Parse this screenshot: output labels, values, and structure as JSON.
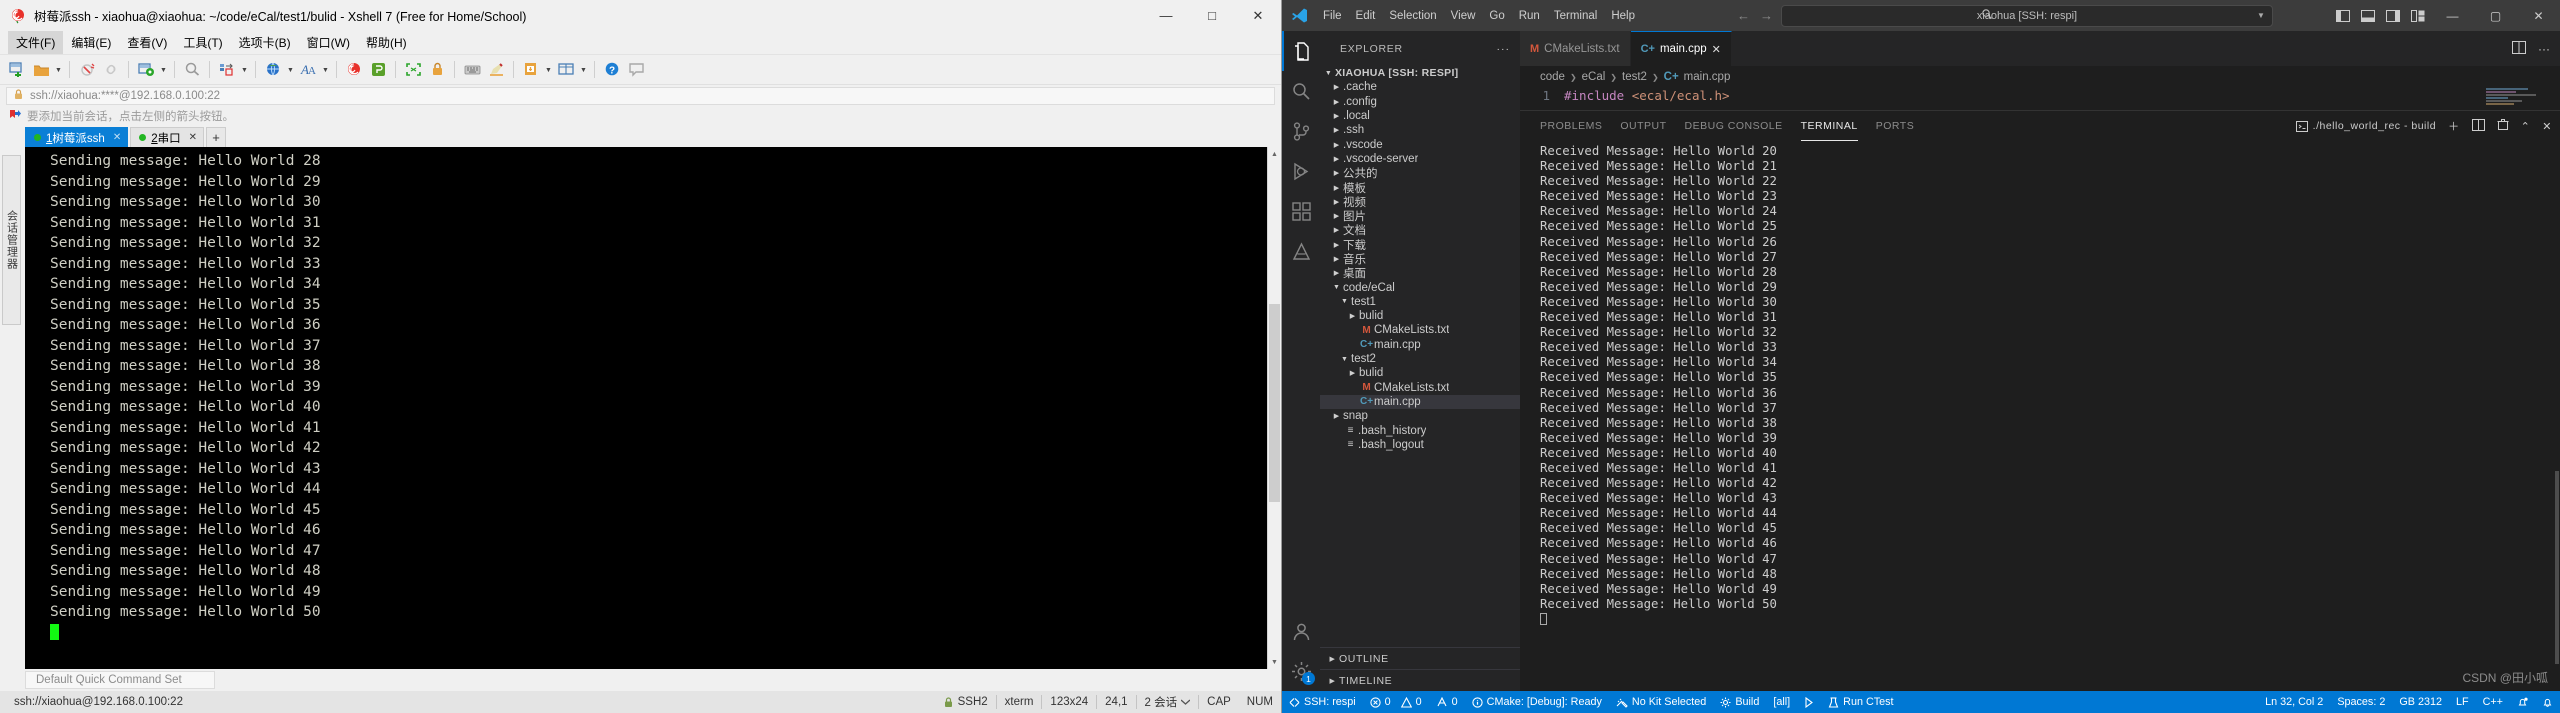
{
  "xshell": {
    "window_title": "树莓派ssh - xiaohua@xiaohua: ~/code/eCal/test1/bulid - Xshell 7 (Free for Home/School)",
    "logo_icon": "rose-icon",
    "window_buttons": [
      {
        "name": "minimize-button",
        "glyph": "—"
      },
      {
        "name": "maximize-button",
        "glyph": "□"
      },
      {
        "name": "close-button",
        "glyph": "✕"
      }
    ],
    "menu": [
      {
        "label": "文件(F)",
        "active": true
      },
      {
        "label": "编辑(E)",
        "active": false
      },
      {
        "label": "查看(V)",
        "active": false
      },
      {
        "label": "工具(T)",
        "active": false
      },
      {
        "label": "选项卡(B)",
        "active": false
      },
      {
        "label": "窗口(W)",
        "active": false
      },
      {
        "label": "帮助(H)",
        "active": false
      }
    ],
    "address": {
      "lock_icon": "lock-icon",
      "value": "ssh://xiaohua:****@192.168.0.100:22"
    },
    "notice": {
      "icon": "bookmark-arrow-icon",
      "text": "要添加当前会话，点击左侧的箭头按钮。"
    },
    "tabs": [
      {
        "label_num": "1",
        "label_rest": "树莓派ssh",
        "active": true,
        "dot_color": "#21b521"
      },
      {
        "label_num": "2",
        "label_rest": "串口",
        "active": false,
        "dot_color": "#21b521"
      }
    ],
    "tab_add_label": "+",
    "side_tab_label": "会话管理器",
    "terminal_lines": [
      "Sending message: Hello World 28",
      "Sending message: Hello World 29",
      "Sending message: Hello World 30",
      "Sending message: Hello World 31",
      "Sending message: Hello World 32",
      "Sending message: Hello World 33",
      "Sending message: Hello World 34",
      "Sending message: Hello World 35",
      "Sending message: Hello World 36",
      "Sending message: Hello World 37",
      "Sending message: Hello World 38",
      "Sending message: Hello World 39",
      "Sending message: Hello World 40",
      "Sending message: Hello World 41",
      "Sending message: Hello World 42",
      "Sending message: Hello World 43",
      "Sending message: Hello World 44",
      "Sending message: Hello World 45",
      "Sending message: Hello World 46",
      "Sending message: Hello World 47",
      "Sending message: Hello World 48",
      "Sending message: Hello World 49",
      "Sending message: Hello World 50"
    ],
    "quick_command_set": "Default Quick Command Set",
    "statusbar": {
      "connection": "ssh://xiaohua@192.168.0.100:22",
      "protocol": "SSH2",
      "term_type": "xterm",
      "size": "123x24",
      "cursor": "24,1",
      "sessions": "2 会话",
      "caps": "CAP",
      "num": "NUM"
    }
  },
  "vscode": {
    "logo_icon": "vscode-logo-icon",
    "menu": [
      "File",
      "Edit",
      "Selection",
      "View",
      "Go",
      "Run",
      "Terminal",
      "Help"
    ],
    "nav_back_icon": "arrow-left-icon",
    "nav_forward_icon": "arrow-right-icon",
    "search": {
      "icon": "search-icon",
      "value": "xiaohua [SSH: respi]",
      "chevron_icon": "chevron-down-icon"
    },
    "layout_icons": [
      "panel-left-icon",
      "panel-bottom-icon",
      "panel-right-icon",
      "layout-grid-icon"
    ],
    "window_buttons": [
      {
        "name": "minimize-button",
        "glyph": "—"
      },
      {
        "name": "maximize-button",
        "glyph": "▢"
      },
      {
        "name": "close-button",
        "glyph": "✕"
      }
    ],
    "activitybar": [
      {
        "name": "explorer",
        "icon": "files-icon",
        "active": true
      },
      {
        "name": "search",
        "icon": "search-icon",
        "active": false
      },
      {
        "name": "source-control",
        "icon": "source-control-icon",
        "active": false
      },
      {
        "name": "run-debug",
        "icon": "debug-icon",
        "active": false
      },
      {
        "name": "extensions",
        "icon": "extensions-icon",
        "active": false
      },
      {
        "name": "cmake",
        "icon": "cmake-icon",
        "active": false
      }
    ],
    "activitybar_bottom": [
      {
        "name": "accounts",
        "icon": "account-icon"
      },
      {
        "name": "settings",
        "icon": "gear-icon",
        "badge": "1"
      }
    ],
    "explorer": {
      "title": "EXPLORER",
      "more_icon": "ellipsis-icon",
      "tree": [
        {
          "label": "XIAOHUA [SSH: RESPI]",
          "chev": "v",
          "root": true,
          "indent": 0
        },
        {
          "label": ".cache",
          "chev": ">",
          "indent": 1
        },
        {
          "label": ".config",
          "chev": ">",
          "indent": 1
        },
        {
          "label": ".local",
          "chev": ">",
          "indent": 1
        },
        {
          "label": ".ssh",
          "chev": ">",
          "indent": 1
        },
        {
          "label": ".vscode",
          "chev": ">",
          "indent": 1
        },
        {
          "label": ".vscode-server",
          "chev": ">",
          "indent": 1
        },
        {
          "label": "公共的",
          "chev": ">",
          "indent": 1
        },
        {
          "label": "模板",
          "chev": ">",
          "indent": 1
        },
        {
          "label": "视频",
          "chev": ">",
          "indent": 1
        },
        {
          "label": "图片",
          "chev": ">",
          "indent": 1
        },
        {
          "label": "文档",
          "chev": ">",
          "indent": 1
        },
        {
          "label": "下载",
          "chev": ">",
          "indent": 1
        },
        {
          "label": "音乐",
          "chev": ">",
          "indent": 1
        },
        {
          "label": "桌面",
          "chev": ">",
          "indent": 1
        },
        {
          "label": "code/eCal",
          "chev": "v",
          "indent": 1
        },
        {
          "label": "test1",
          "chev": "v",
          "indent": 2
        },
        {
          "label": "bulid",
          "chev": ">",
          "indent": 3
        },
        {
          "label": "CMakeLists.txt",
          "chev": "",
          "icon": "M",
          "icon_color": "#d3573c",
          "indent": 3
        },
        {
          "label": "main.cpp",
          "chev": "",
          "icon": "C+",
          "icon_color": "#519aba",
          "indent": 3
        },
        {
          "label": "test2",
          "chev": "v",
          "indent": 2
        },
        {
          "label": "bulid",
          "chev": ">",
          "indent": 3
        },
        {
          "label": "CMakeLists.txt",
          "chev": "",
          "icon": "M",
          "icon_color": "#d3573c",
          "indent": 3
        },
        {
          "label": "main.cpp",
          "chev": "",
          "icon": "C+",
          "icon_color": "#519aba",
          "indent": 3,
          "selected": true
        },
        {
          "label": "snap",
          "chev": ">",
          "indent": 1
        },
        {
          "label": ".bash_history",
          "chev": "",
          "icon": "≡",
          "icon_color": "#cccccc",
          "indent": 1
        },
        {
          "label": ".bash_logout",
          "chev": "",
          "icon": "≡",
          "icon_color": "#cccccc",
          "indent": 1
        }
      ],
      "sections": [
        {
          "label": "OUTLINE",
          "chev": ">"
        },
        {
          "label": "TIMELINE",
          "chev": ">"
        }
      ]
    },
    "editor_tabs": [
      {
        "label": "CMakeLists.txt",
        "icon": "M",
        "icon_color": "#d3573c",
        "active": false,
        "close": ""
      },
      {
        "label": "main.cpp",
        "icon": "C+",
        "icon_color": "#519aba",
        "active": true,
        "close": "✕"
      }
    ],
    "editor_actions": [
      "split-editor-icon",
      "more-actions-icon"
    ],
    "breadcrumb": [
      "code",
      "eCal",
      "test2",
      "main.cpp"
    ],
    "breadcrumb_file_icon": "C+",
    "code_line": {
      "number": "1",
      "include_kw": "#include",
      "include_path": "<ecal/ecal.h>"
    },
    "panel": {
      "tabs": [
        {
          "label": "PROBLEMS",
          "active": false
        },
        {
          "label": "OUTPUT",
          "active": false
        },
        {
          "label": "DEBUG CONSOLE",
          "active": false
        },
        {
          "label": "TERMINAL",
          "active": true
        },
        {
          "label": "PORTS",
          "active": false
        }
      ],
      "terminal_select": "./hello_world_rec - build",
      "actions": [
        "new-terminal-icon",
        "split-terminal-icon",
        "kill-terminal-icon",
        "chevron-up-icon",
        "close-panel-icon"
      ],
      "lines": [
        "Received Message: Hello World 20",
        "Received Message: Hello World 21",
        "Received Message: Hello World 22",
        "Received Message: Hello World 23",
        "Received Message: Hello World 24",
        "Received Message: Hello World 25",
        "Received Message: Hello World 26",
        "Received Message: Hello World 27",
        "Received Message: Hello World 28",
        "Received Message: Hello World 29",
        "Received Message: Hello World 30",
        "Received Message: Hello World 31",
        "Received Message: Hello World 32",
        "Received Message: Hello World 33",
        "Received Message: Hello World 34",
        "Received Message: Hello World 35",
        "Received Message: Hello World 36",
        "Received Message: Hello World 37",
        "Received Message: Hello World 38",
        "Received Message: Hello World 39",
        "Received Message: Hello World 40",
        "Received Message: Hello World 41",
        "Received Message: Hello World 42",
        "Received Message: Hello World 43",
        "Received Message: Hello World 44",
        "Received Message: Hello World 45",
        "Received Message: Hello World 46",
        "Received Message: Hello World 47",
        "Received Message: Hello World 48",
        "Received Message: Hello World 49",
        "Received Message: Hello World 50"
      ]
    },
    "watermark": "CSDN @田小呱",
    "statusbar": {
      "accent": "#0078d4",
      "left": [
        {
          "icon": "remote-icon",
          "label": "SSH: respi"
        },
        {
          "icon": "error-icon",
          "label": "0"
        },
        {
          "icon": "warning-icon",
          "label": "0"
        },
        {
          "icon": "radio-tower-icon",
          "label": "0"
        },
        {
          "icon": "info-icon",
          "label": "CMake: [Debug]: Ready"
        },
        {
          "icon": "tools-icon",
          "label": "No Kit Selected"
        },
        {
          "icon": "gear-icon",
          "label": "Build"
        },
        {
          "icon": "",
          "label": "[all]"
        },
        {
          "icon": "play-icon",
          "label": ""
        },
        {
          "icon": "beaker-icon",
          "label": "Run CTest"
        }
      ],
      "right": [
        {
          "label": "Ln 32, Col 2"
        },
        {
          "label": "Spaces: 2"
        },
        {
          "label": "GB 2312"
        },
        {
          "label": "LF"
        },
        {
          "label": "C++"
        },
        {
          "icon": "bell-dot-icon",
          "label": ""
        },
        {
          "icon": "bell-icon",
          "label": ""
        }
      ]
    }
  }
}
